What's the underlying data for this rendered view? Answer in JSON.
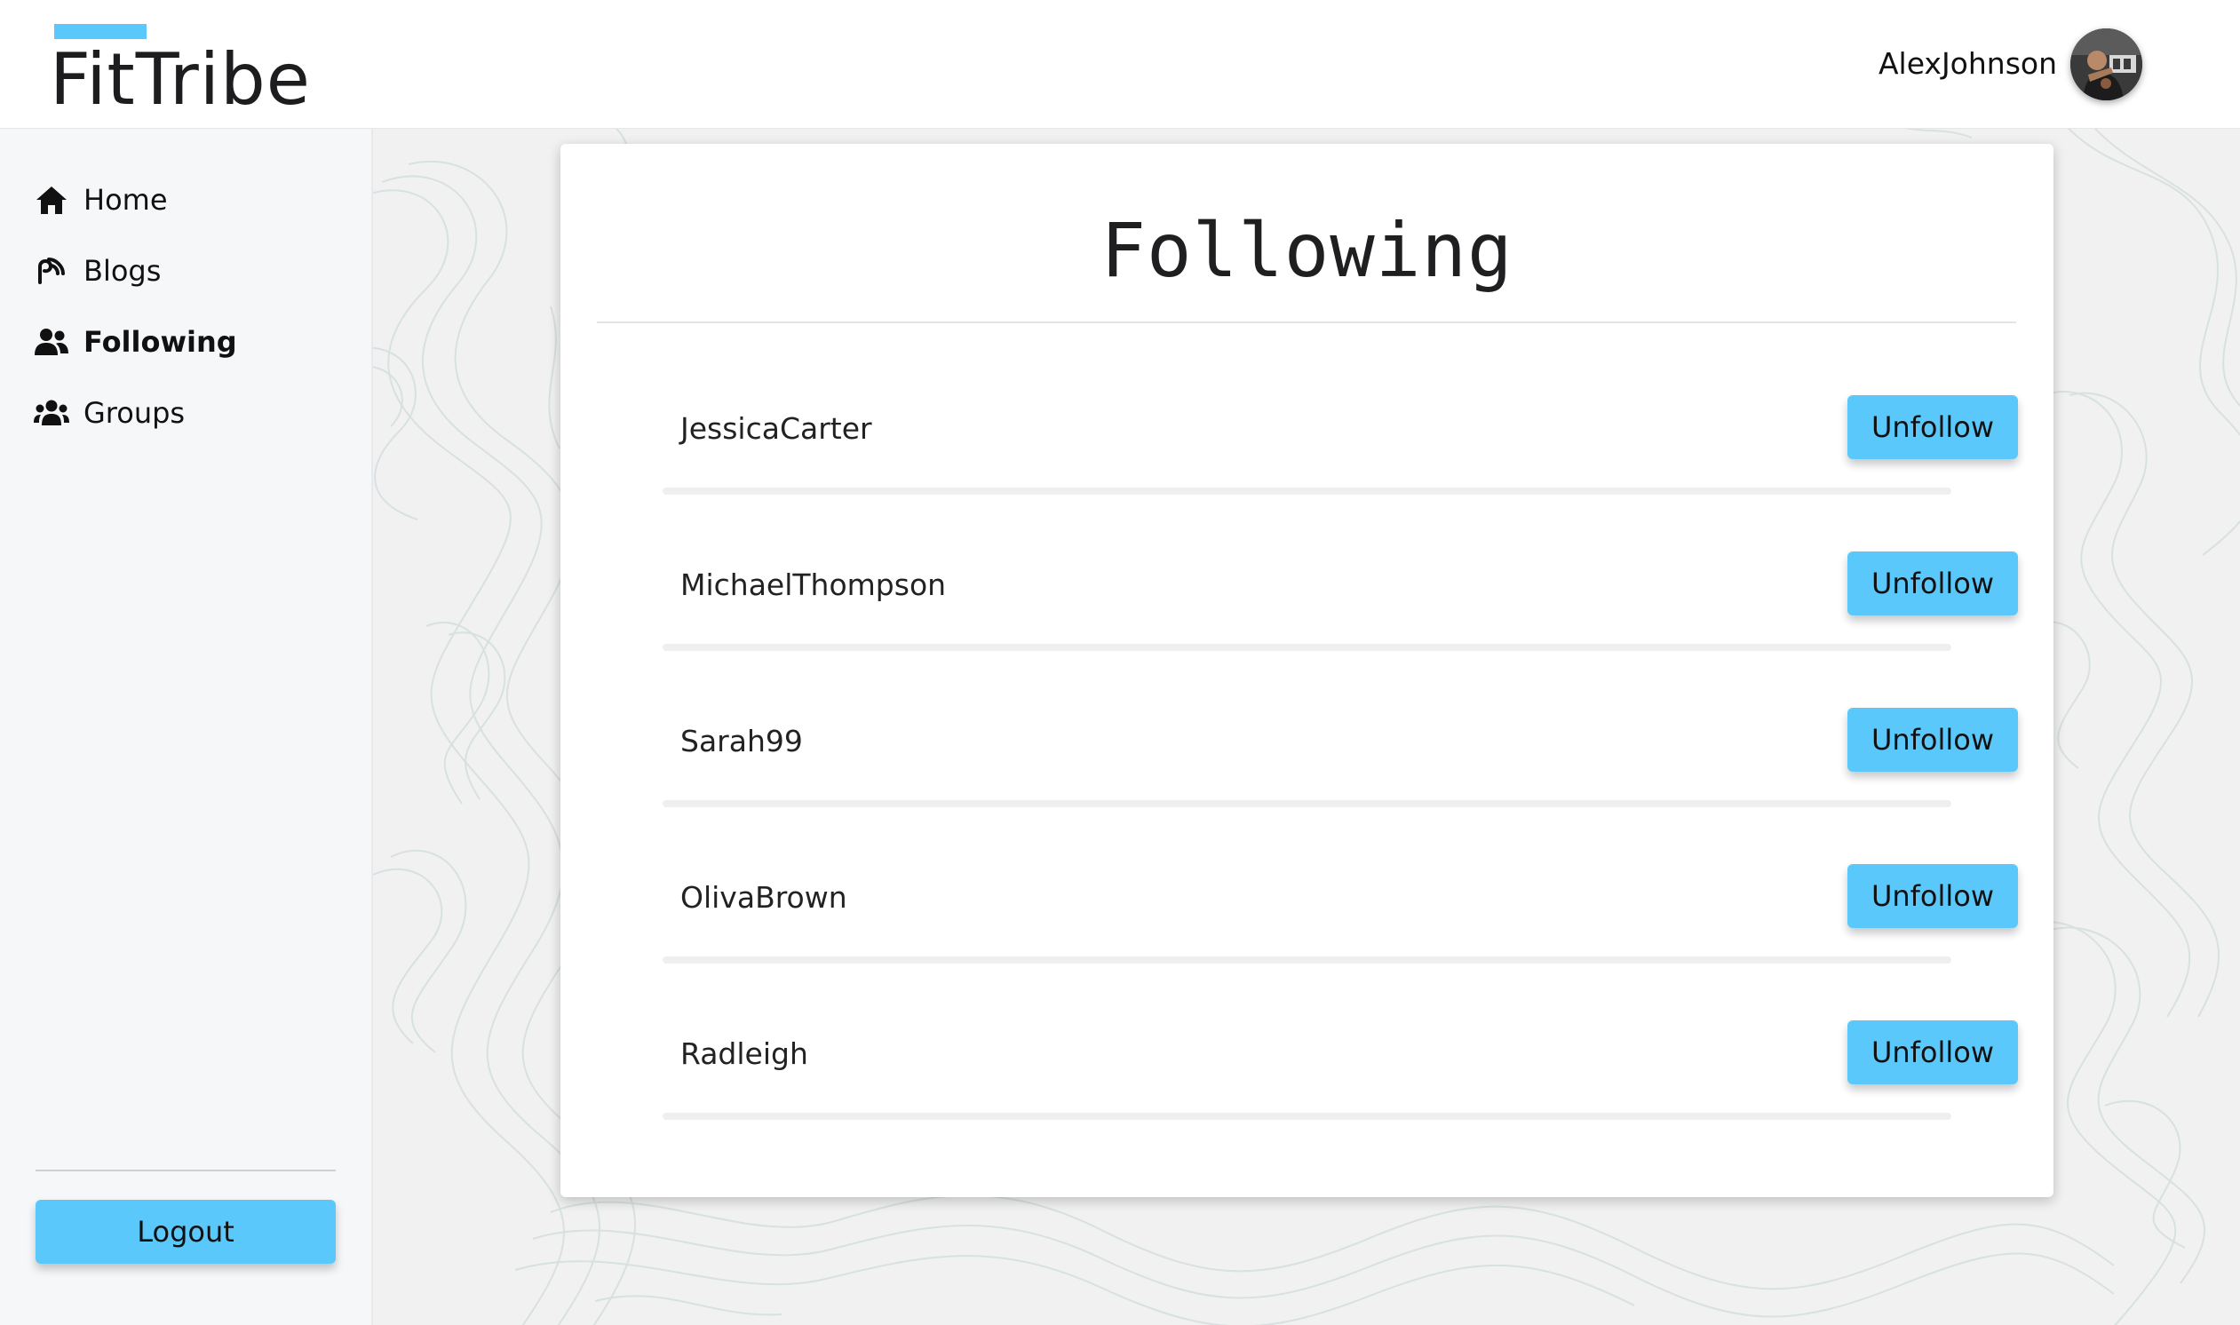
{
  "app": {
    "brand": "FitTribe",
    "accent_color": "#5ac8fa"
  },
  "header": {
    "username": "AlexJohnson",
    "avatar_icon": "user-avatar-photo"
  },
  "sidebar": {
    "items": [
      {
        "label": "Home",
        "icon": "home-icon",
        "active": false
      },
      {
        "label": "Blogs",
        "icon": "blog-icon",
        "active": false
      },
      {
        "label": "Following",
        "icon": "user-friends-icon",
        "active": true
      },
      {
        "label": "Groups",
        "icon": "users-icon",
        "active": false
      }
    ],
    "logout_label": "Logout"
  },
  "main": {
    "title": "Following",
    "following": [
      {
        "name": "JessicaCarter",
        "action": "Unfollow"
      },
      {
        "name": "MichaelThompson",
        "action": "Unfollow"
      },
      {
        "name": "Sarah99",
        "action": "Unfollow"
      },
      {
        "name": "OlivaBrown",
        "action": "Unfollow"
      },
      {
        "name": "Radleigh",
        "action": "Unfollow"
      }
    ]
  }
}
